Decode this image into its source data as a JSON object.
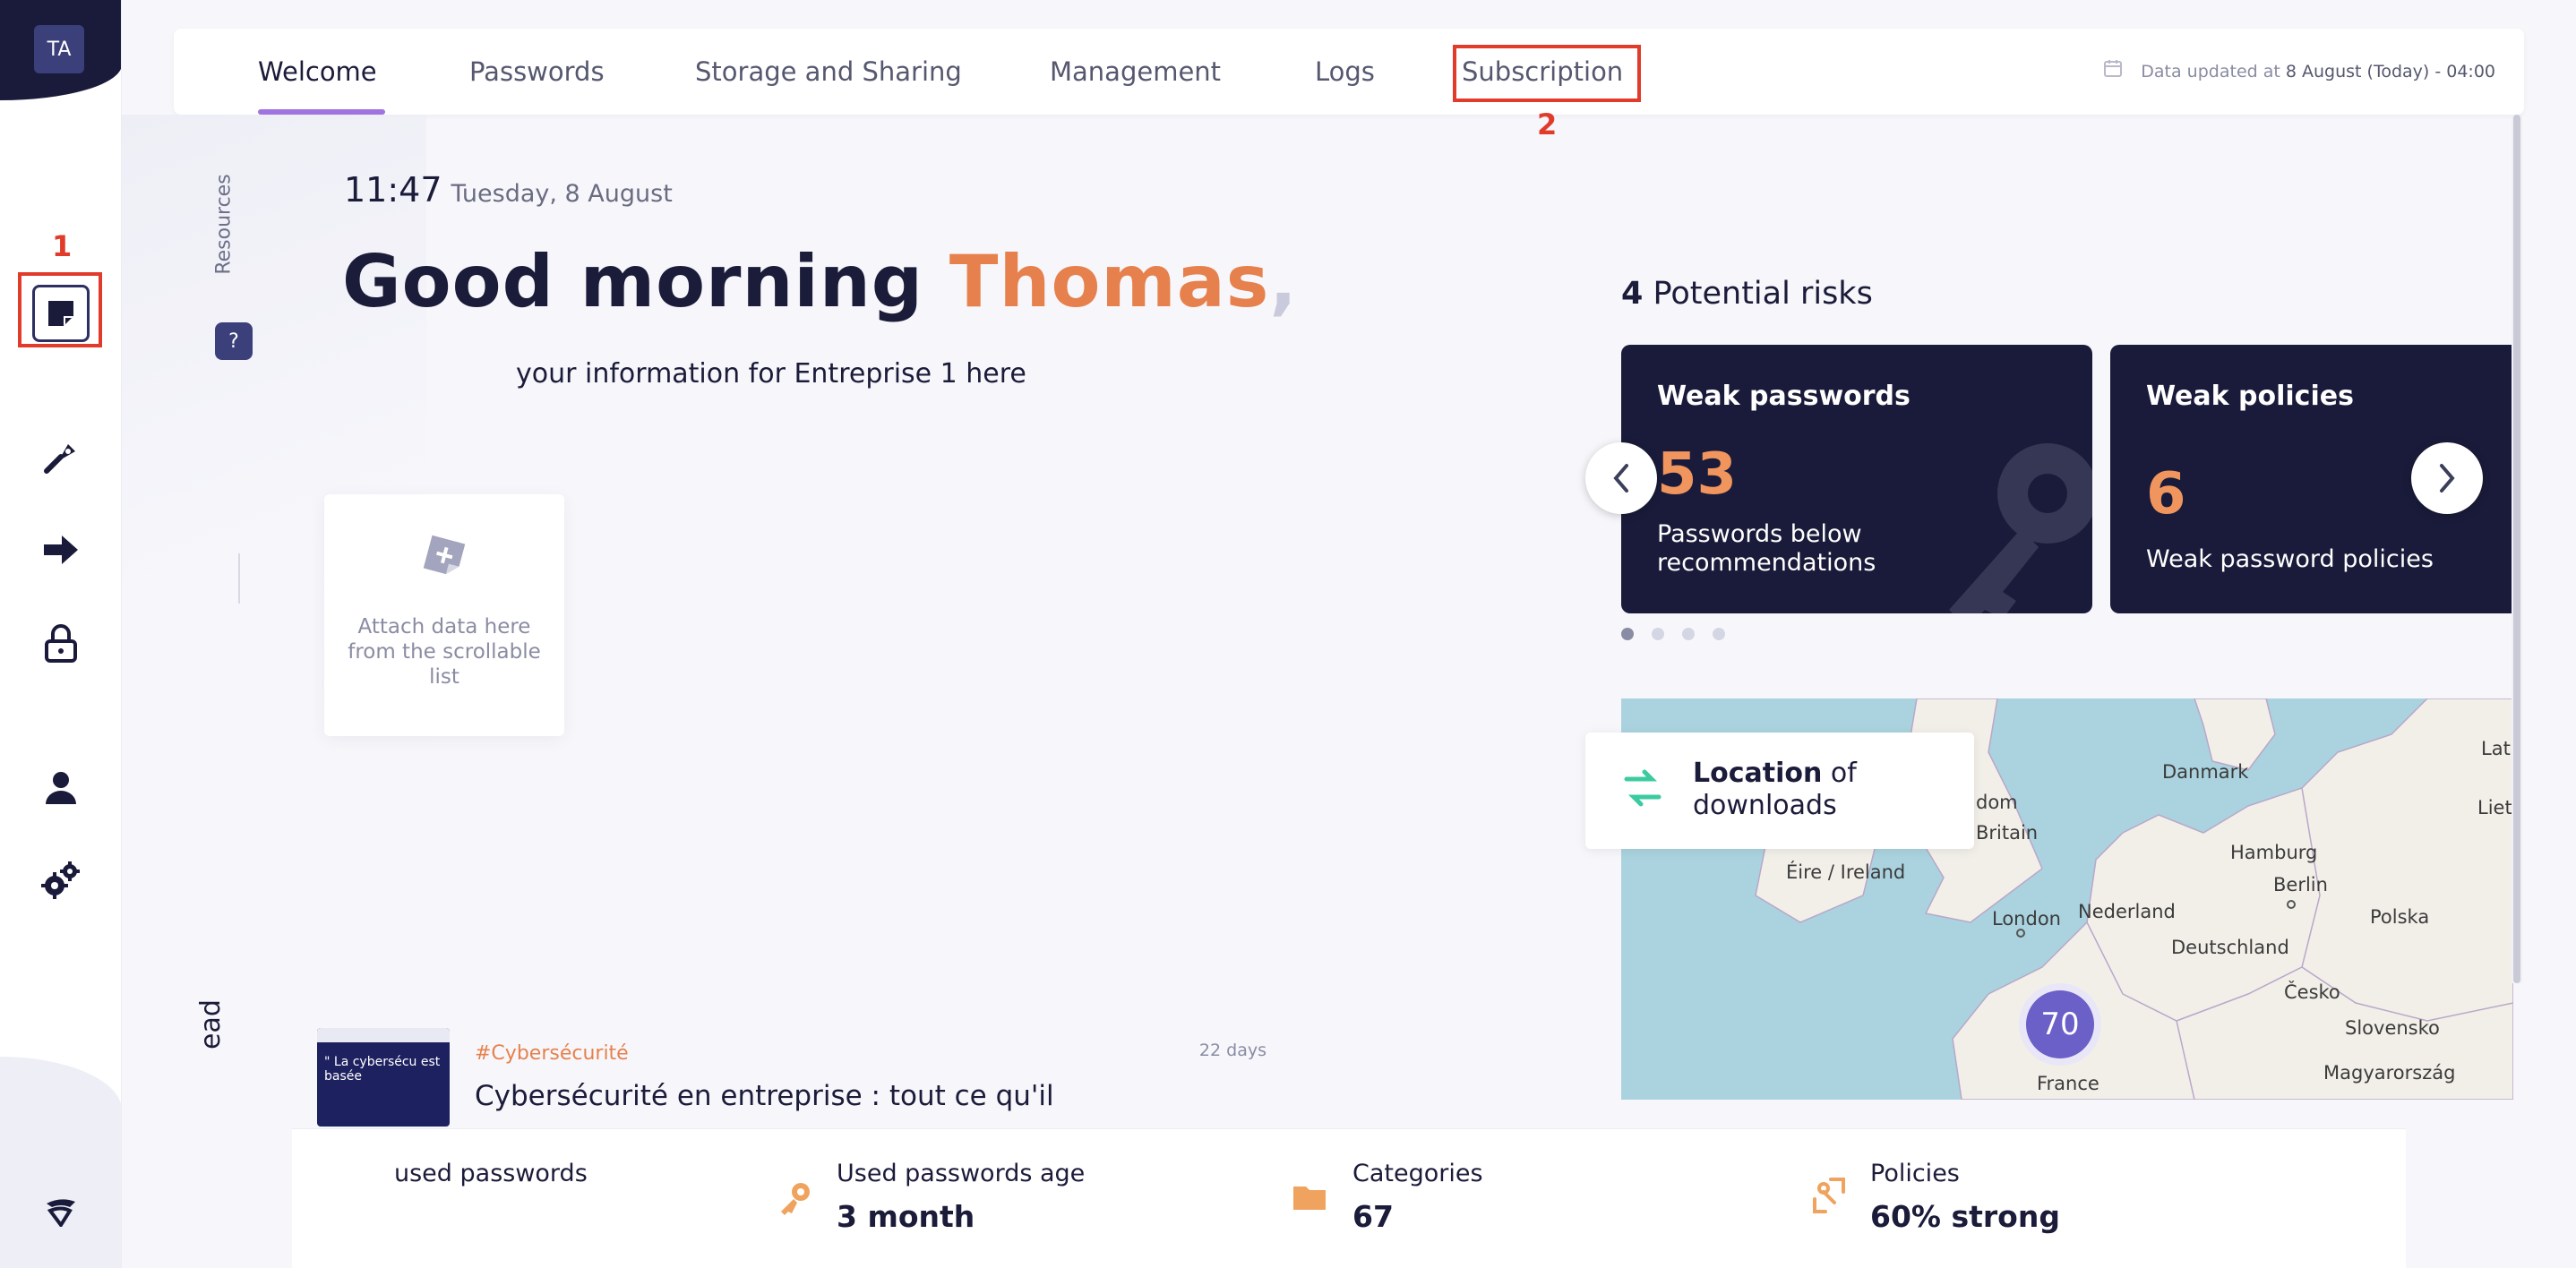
{
  "user": {
    "initials": "TA"
  },
  "nav": {
    "tabs": [
      {
        "label": "Welcome"
      },
      {
        "label": "Passwords"
      },
      {
        "label": "Storage and Sharing"
      },
      {
        "label": "Management"
      },
      {
        "label": "Logs"
      },
      {
        "label": "Subscription"
      }
    ],
    "data_updated_prefix": "Data updated at ",
    "data_updated_value": "8 August (Today) - 04:00"
  },
  "annotations": {
    "first": "1",
    "second": "2"
  },
  "sidebar": {
    "icons": [
      "sticky-note-icon",
      "pen-tool-icon",
      "arrow-right-icon",
      "lock-icon",
      "user-icon",
      "gears-icon",
      "shield-logo-icon"
    ]
  },
  "resources": {
    "label": "Resources",
    "icon": "?"
  },
  "clock": {
    "time": "11:47",
    "date": "Tuesday, 8 August"
  },
  "greeting": {
    "prefix": "Good morning ",
    "name": "Thomas",
    "suffix": ",",
    "subline": "your information for Entreprise 1 here"
  },
  "attach": {
    "text": "Attach data here from the scrollable list"
  },
  "read": {
    "label": "ead"
  },
  "article": {
    "thumb_text": "\" La cybersécu est basée",
    "tag": "#Cybersécurité",
    "age": "22 days",
    "title": "Cybersécurité en entreprise : tout ce qu'il"
  },
  "risks": {
    "count": "4",
    "title": "Potential risks",
    "cards": [
      {
        "title": "Weak passwords",
        "value": "53",
        "desc": "Passwords below recommendations"
      },
      {
        "title": "Weak policies",
        "value": "6",
        "desc": "Weak password policies"
      }
    ],
    "dots": 4,
    "active_dot": 0
  },
  "map": {
    "card_title_bold": "Location",
    "card_title_rest": " of downloads",
    "cluster": "70",
    "labels": [
      "Danmark",
      "dom",
      "Britain",
      "Éire / Ireland",
      "Hamburg",
      "Berlin",
      "London",
      "Nederland",
      "Deutschland",
      "Polska",
      "Česko",
      "Slovensko",
      "Magyarország",
      "France",
      "Lat",
      "Liet"
    ]
  },
  "stats": [
    {
      "label": "used passwords",
      "value": ""
    },
    {
      "label": "Used passwords age",
      "value": "3 month"
    },
    {
      "label": "Categories",
      "value": "67"
    },
    {
      "label": "Policies",
      "value": "60% strong"
    }
  ],
  "colors": {
    "navy": "#1a1b3a",
    "accent_orange": "#e6814d",
    "accent_purple": "#a073e0",
    "highlight_red": "#e03b2b",
    "stat_icon_orange": "#f0a35e"
  }
}
